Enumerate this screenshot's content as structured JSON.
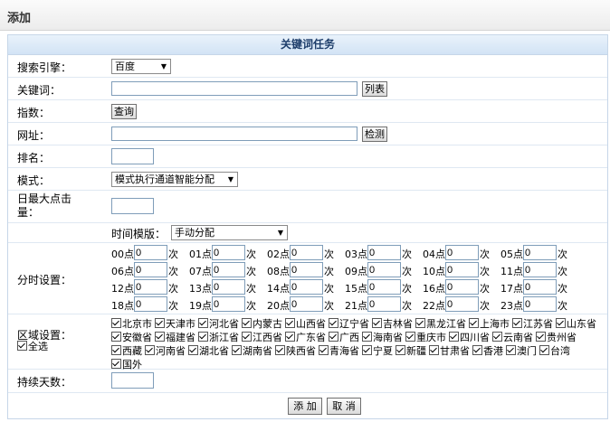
{
  "page": {
    "title": "添加"
  },
  "panel": {
    "title": "关键词任务"
  },
  "fields": {
    "engine_label": "搜索引擎：",
    "engine_value": "百度",
    "keyword_label": "关键词：",
    "keyword_value": "",
    "list_button": "列表",
    "index_label": "指数：",
    "query_button": "查询",
    "url_label": "网址：",
    "url_value": "",
    "detect_button": "检测",
    "rank_label": "排名：",
    "rank_value": "",
    "mode_label": "模式：",
    "mode_value": "模式执行通道智能分配",
    "max_clicks_label": "日最大点击量：",
    "max_clicks_value": "",
    "template_label": "时间模版：",
    "template_value": "手动分配",
    "hourly_label": "分时设置：",
    "region_label": "区域设置：",
    "select_all": "全选",
    "days_label": "持续天数：",
    "days_value": ""
  },
  "hours": [
    {
      "label": "00点",
      "value": "0",
      "unit": "次"
    },
    {
      "label": "01点",
      "value": "0",
      "unit": "次"
    },
    {
      "label": "02点",
      "value": "0",
      "unit": "次"
    },
    {
      "label": "03点",
      "value": "0",
      "unit": "次"
    },
    {
      "label": "04点",
      "value": "0",
      "unit": "次"
    },
    {
      "label": "05点",
      "value": "0",
      "unit": "次"
    },
    {
      "label": "06点",
      "value": "0",
      "unit": "次"
    },
    {
      "label": "07点",
      "value": "0",
      "unit": "次"
    },
    {
      "label": "08点",
      "value": "0",
      "unit": "次"
    },
    {
      "label": "09点",
      "value": "0",
      "unit": "次"
    },
    {
      "label": "10点",
      "value": "0",
      "unit": "次"
    },
    {
      "label": "11点",
      "value": "0",
      "unit": "次"
    },
    {
      "label": "12点",
      "value": "0",
      "unit": "次"
    },
    {
      "label": "13点",
      "value": "0",
      "unit": "次"
    },
    {
      "label": "14点",
      "value": "0",
      "unit": "次"
    },
    {
      "label": "15点",
      "value": "0",
      "unit": "次"
    },
    {
      "label": "16点",
      "value": "0",
      "unit": "次"
    },
    {
      "label": "17点",
      "value": "0",
      "unit": "次"
    },
    {
      "label": "18点",
      "value": "0",
      "unit": "次"
    },
    {
      "label": "19点",
      "value": "0",
      "unit": "次"
    },
    {
      "label": "20点",
      "value": "0",
      "unit": "次"
    },
    {
      "label": "21点",
      "value": "0",
      "unit": "次"
    },
    {
      "label": "22点",
      "value": "0",
      "unit": "次"
    },
    {
      "label": "23点",
      "value": "0",
      "unit": "次"
    }
  ],
  "regions": [
    "北京市",
    "天津市",
    "河北省",
    "内蒙古",
    "山西省",
    "辽宁省",
    "吉林省",
    "黑龙江省",
    "上海市",
    "江苏省",
    "山东省",
    "安徽省",
    "福建省",
    "浙江省",
    "江西省",
    "广东省",
    "广西",
    "海南省",
    "重庆市",
    "四川省",
    "云南省",
    "贵州省",
    "西藏",
    "河南省",
    "湖北省",
    "湖南省",
    "陕西省",
    "青海省",
    "宁夏",
    "新疆",
    "甘肃省",
    "香港",
    "澳门",
    "台湾",
    "国外"
  ],
  "actions": {
    "add": "添 加",
    "cancel": "取 消"
  }
}
